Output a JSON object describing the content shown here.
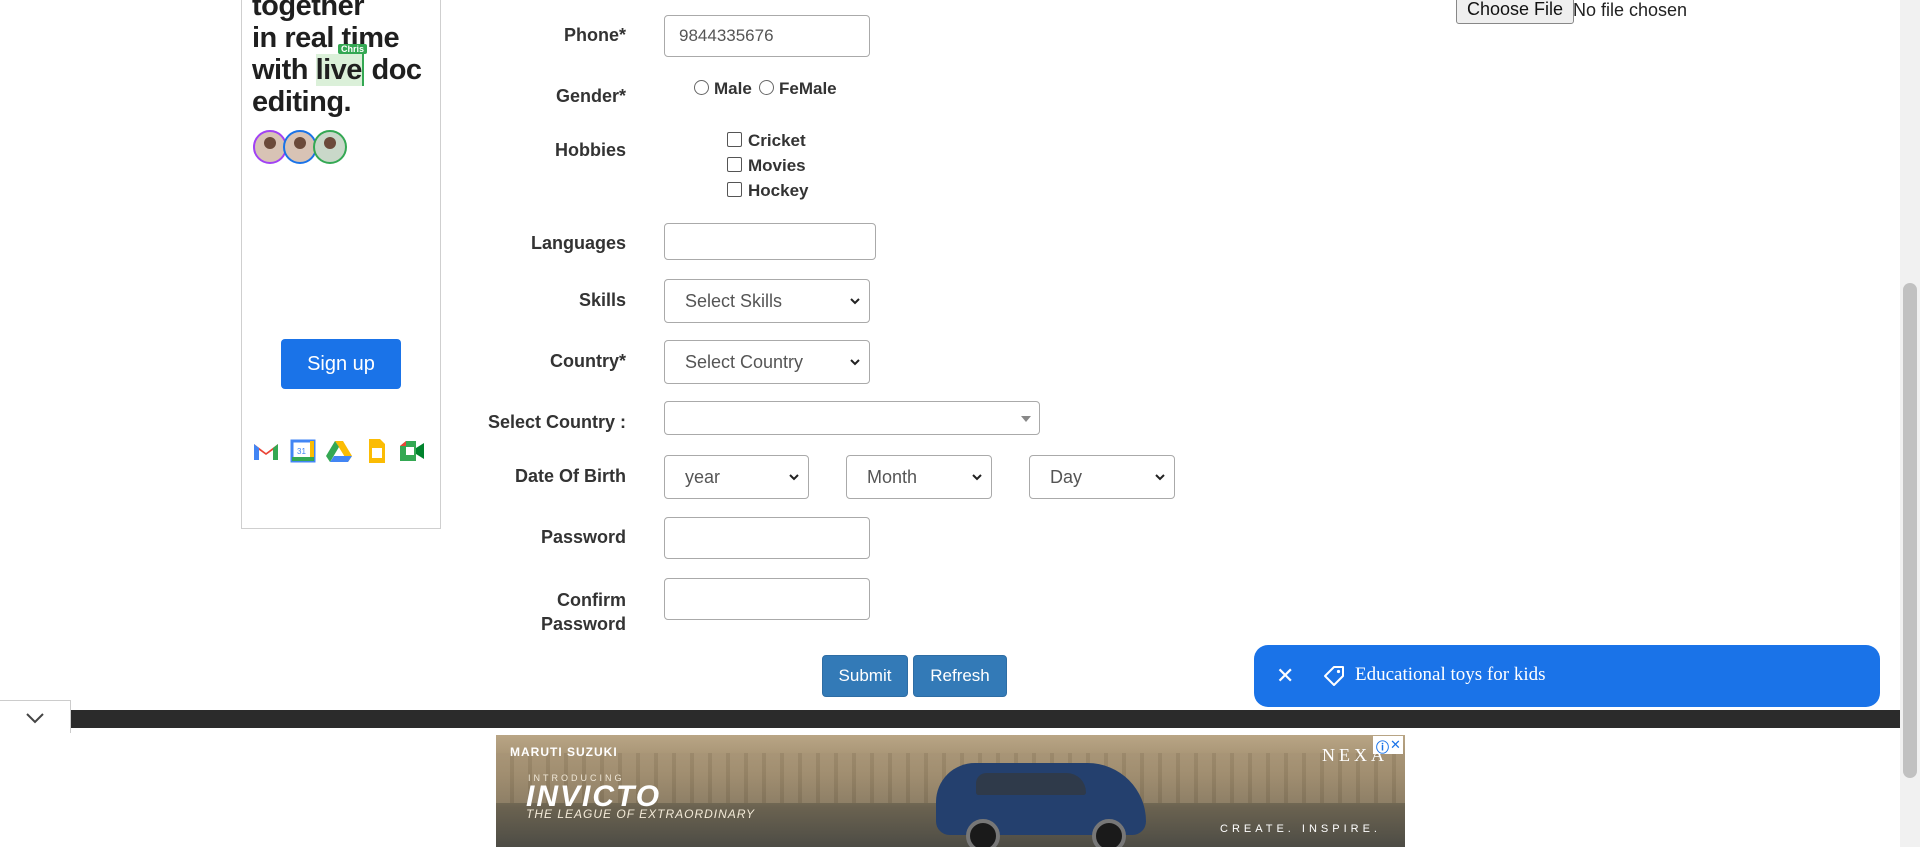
{
  "left_ad": {
    "headline_line1": "together",
    "headline_line2": "in real time",
    "headline_with": "with",
    "headline_live": "live",
    "headline_doc": "doc",
    "headline_line4": "editing.",
    "collab_tag": "Chris",
    "signup_label": "Sign up",
    "app_icons": [
      "gmail-icon",
      "calendar-icon",
      "drive-icon",
      "docs-icon",
      "meet-icon"
    ],
    "calendar_day": "31"
  },
  "form": {
    "phone_label": "Phone*",
    "phone_value": "9844335676",
    "gender_label": "Gender*",
    "gender_options": [
      "Male",
      "FeMale"
    ],
    "hobbies_label": "Hobbies",
    "hobbies": [
      "Cricket",
      "Movies",
      "Hockey"
    ],
    "languages_label": "Languages",
    "skills_label": "Skills",
    "skills_placeholder": "Select Skills",
    "country_label": "Country*",
    "country_placeholder": "Select Country",
    "select_country_label": "Select Country :",
    "dob_label": "Date Of Birth",
    "dob_year": "year",
    "dob_month": "Month",
    "dob_day": "Day",
    "password_label": "Password",
    "confirm_label_line1": "Confirm",
    "confirm_label_line2": "Password",
    "submit_label": "Submit",
    "refresh_label": "Refresh",
    "file_button": "Choose File",
    "file_status": "No file chosen"
  },
  "toast": {
    "text": "Educational toys for kids"
  },
  "banner_ad": {
    "brand": "MARUTI SUZUKI",
    "intro": "INTRODUCING",
    "model": "INVICTO",
    "tagline": "THE LEAGUE OF EXTRAORDINARY",
    "dealer": "NEXA",
    "slogan": "CREATE. INSPIRE."
  },
  "colors": {
    "brand_blue": "#1a73e8",
    "button_blue": "#337ab7",
    "footer_dark": "#2b2b2b"
  }
}
